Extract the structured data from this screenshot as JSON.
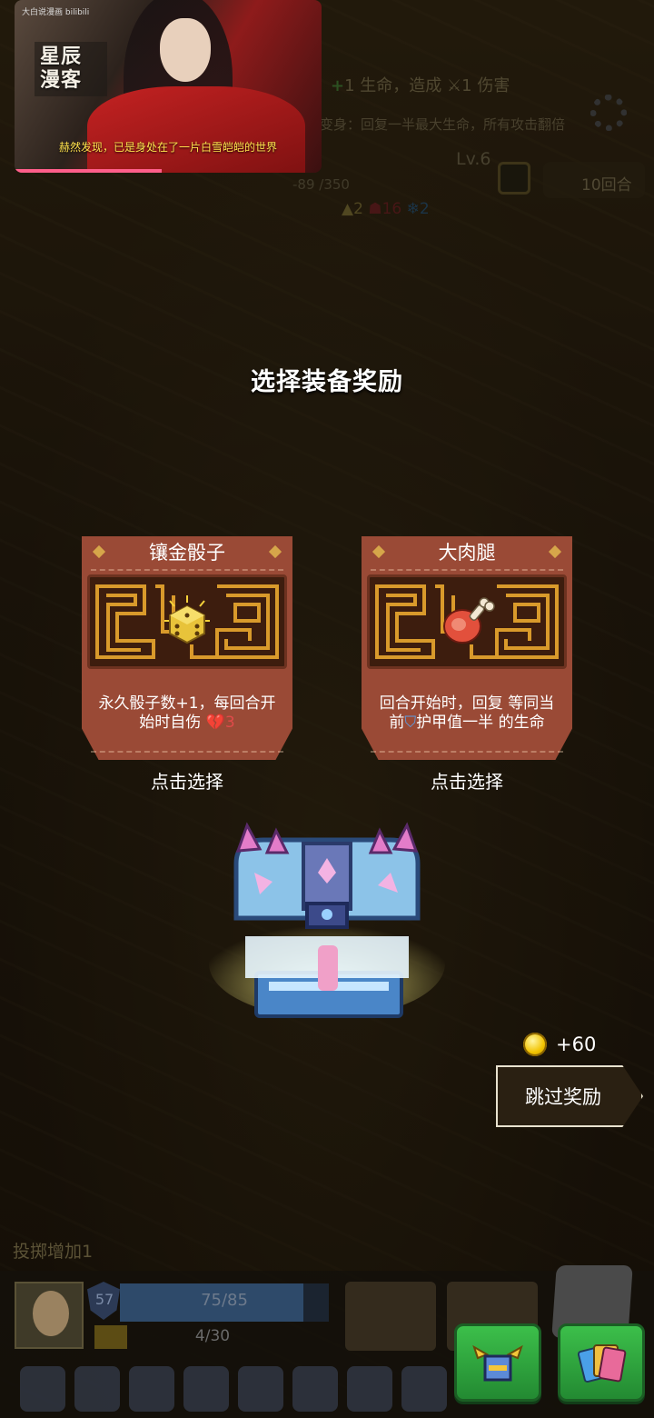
{
  "video": {
    "small_tag": "大白说漫画 bilibili",
    "title_line1": "星辰",
    "title_line2": "漫客",
    "caption": "赫然发现，已是身处在了一片白雪皑皑的世界",
    "progress_fraction": 0.48
  },
  "hud": {
    "life_text": "1 生命，造成",
    "life_plus": "+",
    "damage_text": "1 伤害",
    "transform_text": "变身：回复一半最大生命，所有攻击翻倍",
    "level": "Lv.6",
    "hp_text": "-89 /350",
    "rounds": "10回合",
    "stat_yellow": "2",
    "stat_red": "16",
    "stat_blue": "2"
  },
  "reward_screen": {
    "title": "选择装备奖励",
    "cards": [
      {
        "name": "镶金骰子",
        "icon": "gold-dice-icon",
        "description": "永久骰子数+1，每回合开始时自伤",
        "self_damage": "3",
        "select_label": "点击选择"
      },
      {
        "name": "大肉腿",
        "icon": "meat-leg-icon",
        "description_before": "回合开始时，回复 等同当前",
        "description_after": "护甲值一半 的生命",
        "select_label": "点击选择"
      }
    ],
    "coin_reward": "+60",
    "skip_label": "跳过奖励"
  },
  "bottom": {
    "bonus_text": "投掷增加1",
    "shield_value": "57",
    "hp": "75/85",
    "hp_fraction": 0.88,
    "exp": "4/30"
  },
  "colors": {
    "card_bg": "#9a4a36",
    "card_art_bg": "#3d1d0e",
    "maze_gold": "#d99a2b",
    "self_damage": "#e04a4a",
    "button_green": "#3cbf4a",
    "coin": "#f2c300"
  }
}
